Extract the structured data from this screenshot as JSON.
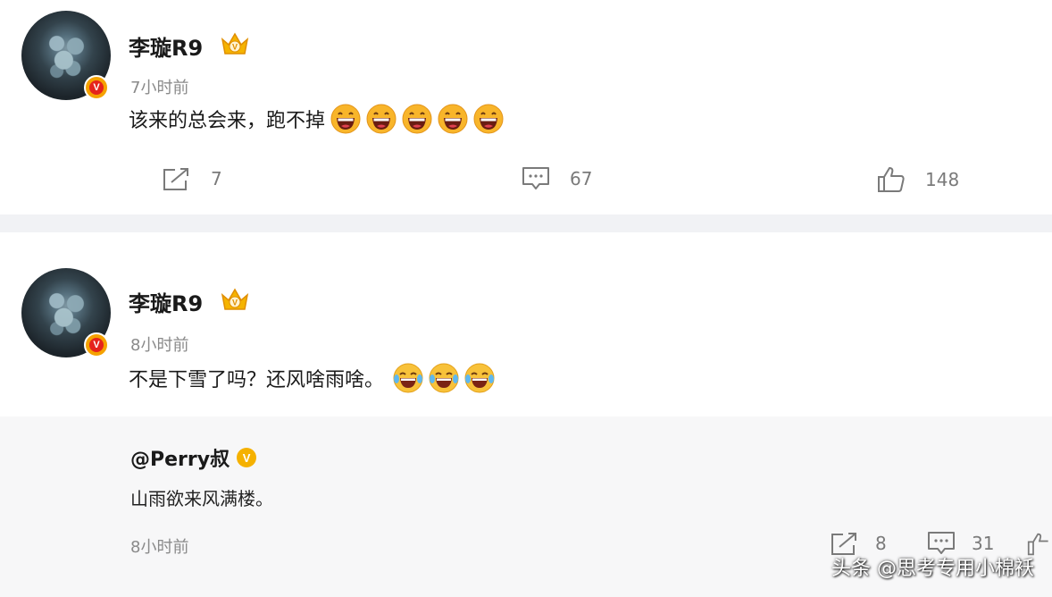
{
  "posts": [
    {
      "username": "李璇R9",
      "time": "7小时前",
      "text": "该来的总会来，跑不掉",
      "emoji_count": 5,
      "emoji_name": "grin-emoji",
      "actions": {
        "repost_count": "7",
        "comment_count": "67",
        "like_count": "148"
      }
    },
    {
      "username": "李璇R9",
      "time": "8小时前",
      "text": "不是下雪了吗？还风啥雨啥。",
      "emoji_count": 3,
      "emoji_name": "laugh-cry-emoji",
      "quote": {
        "author": "@Perry叔",
        "text": "山雨欲来风满楼。",
        "time": "8小时前",
        "repost_count": "8",
        "comment_count": "31"
      }
    }
  ],
  "watermark": "头条 @思考专用小棉袄",
  "badge_colors": {
    "vip_gold": "#f5a200",
    "verified_red": "#e5231c",
    "verified_yellow": "#f5b100"
  }
}
